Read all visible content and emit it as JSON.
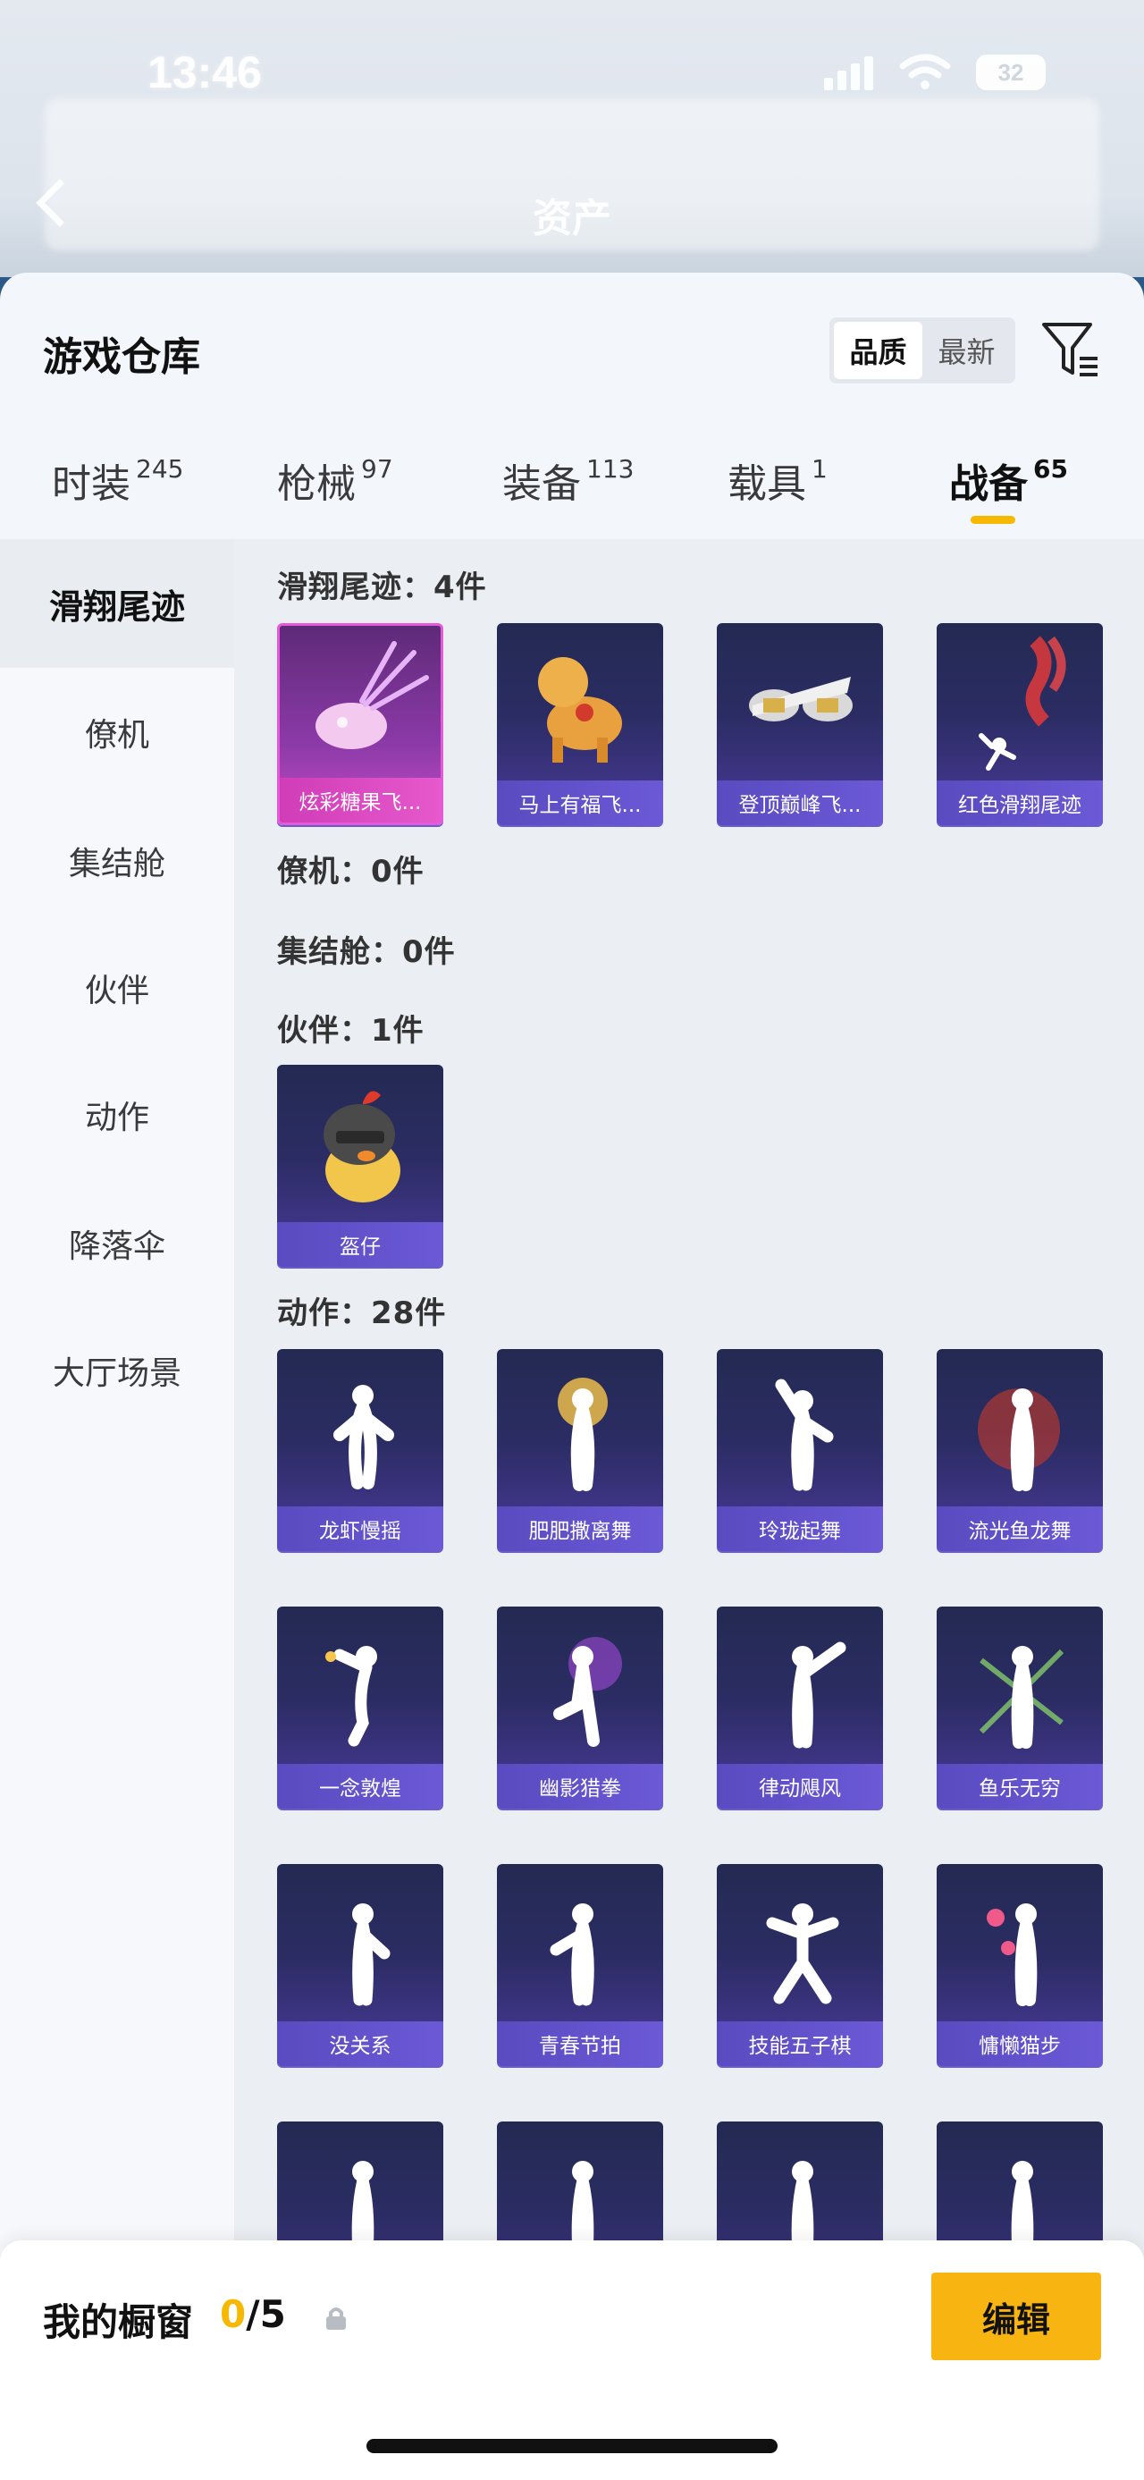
{
  "status": {
    "time": "13:46",
    "battery": "32"
  },
  "nav": {
    "title": "资产"
  },
  "sheet": {
    "title": "游戏仓库",
    "sort_options": [
      "品质",
      "最新"
    ],
    "sort_selected": "品质"
  },
  "tabs": [
    {
      "label": "时装",
      "count": "245"
    },
    {
      "label": "枪械",
      "count": "97"
    },
    {
      "label": "装备",
      "count": "113"
    },
    {
      "label": "载具",
      "count": "1"
    },
    {
      "label": "战备",
      "count": "65",
      "active": true
    }
  ],
  "sidebar": {
    "items": [
      "滑翔尾迹",
      "僚机",
      "集结舱",
      "伙伴",
      "动作",
      "降落伞",
      "大厅场景"
    ],
    "active": "滑翔尾迹"
  },
  "sections": {
    "trail": {
      "title": "滑翔尾迹：4件",
      "items": [
        "炫彩糖果飞...",
        "马上有福飞...",
        "登顶巅峰飞...",
        "红色滑翔尾迹"
      ]
    },
    "wingman": {
      "title": "僚机：0件"
    },
    "pod": {
      "title": "集结舱：0件"
    },
    "partner": {
      "title": "伙伴：1件",
      "items": [
        "盔仔"
      ]
    },
    "emote": {
      "title": "动作：28件",
      "items": [
        "龙虾慢摇",
        "肥肥撒离舞",
        "玲珑起舞",
        "流光鱼龙舞",
        "一念敦煌",
        "幽影猎拳",
        "律动飓风",
        "鱼乐无穷",
        "没关系",
        "青春节拍",
        "技能五子棋",
        "慵懒猫步"
      ]
    }
  },
  "bottom": {
    "title": "我的橱窗",
    "count_current": "0",
    "count_sep_max": "/5",
    "edit_label": "编辑"
  },
  "colors": {
    "accent": "#f8b512",
    "card_purple": "#4a3a9a",
    "card_pink": "#e45ad8"
  }
}
